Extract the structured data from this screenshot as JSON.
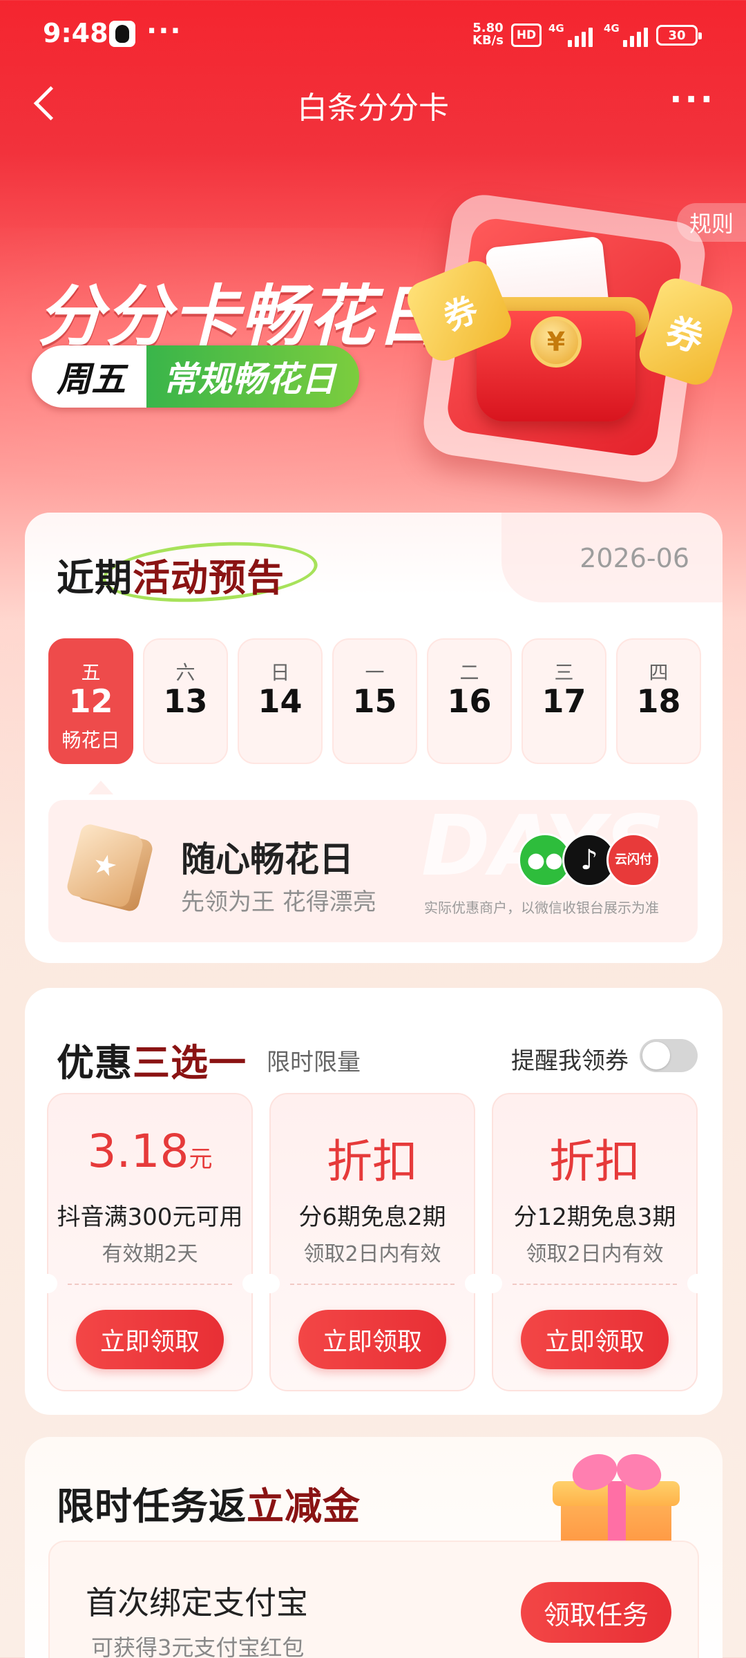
{
  "status_bar": {
    "time": "9:48",
    "more": "···",
    "net_speed_value": "5.80",
    "net_speed_unit": "KB/s",
    "hd": "HD",
    "signal1": "4G",
    "signal2": "4G",
    "battery": "30"
  },
  "nav": {
    "title": "白条分分卡",
    "more": "···"
  },
  "hero": {
    "rules": "规则",
    "title": "分分卡畅花日",
    "pill_day": "周五",
    "pill_label": "常规畅花日",
    "ribbon_left": "券",
    "ribbon_right": "券",
    "coin": "¥"
  },
  "schedule": {
    "title_part1": "近期",
    "title_part2": "活动预告",
    "year_month": "2026-06",
    "days": [
      {
        "weekday": "五",
        "date": "12",
        "tag": "畅花日",
        "active": true
      },
      {
        "weekday": "六",
        "date": "13",
        "tag": "",
        "active": false
      },
      {
        "weekday": "日",
        "date": "14",
        "tag": "",
        "active": false
      },
      {
        "weekday": "一",
        "date": "15",
        "tag": "",
        "active": false
      },
      {
        "weekday": "二",
        "date": "16",
        "tag": "",
        "active": false
      },
      {
        "weekday": "三",
        "date": "17",
        "tag": "",
        "active": false
      },
      {
        "weekday": "四",
        "date": "18",
        "tag": "",
        "active": false
      }
    ],
    "promo": {
      "watermark": "DAYS",
      "title": "随心畅花日",
      "subtitle": "先领为王 花得漂亮",
      "note": "实际优惠商户，以微信收银台展示为准",
      "icons": [
        "wechat-pay-icon",
        "douyin-icon",
        "unionpay-quickpass-icon"
      ],
      "unionpay_label": "云闪付"
    }
  },
  "coupons_section": {
    "title_part1": "优惠",
    "title_part2": "三选一",
    "limit_text": "限时限量",
    "remind_label": "提醒我领券",
    "remind_on": false,
    "coupons": [
      {
        "amount": "3.18",
        "unit": "元",
        "desc": "抖音满300元可用",
        "valid": "有效期2天",
        "button": "立即领取"
      },
      {
        "amount": "折扣",
        "unit": "",
        "desc": "分6期免息2期",
        "valid": "领取2日内有效",
        "button": "立即领取"
      },
      {
        "amount": "折扣",
        "unit": "",
        "desc": "分12期免息3期",
        "valid": "领取2日内有效",
        "button": "立即领取"
      }
    ]
  },
  "task_section": {
    "title_part1": "限时任务返",
    "title_part2": "立减金",
    "task": {
      "title": "首次绑定支付宝",
      "subtitle": "可获得3元支付宝红包",
      "button": "领取任务"
    }
  }
}
